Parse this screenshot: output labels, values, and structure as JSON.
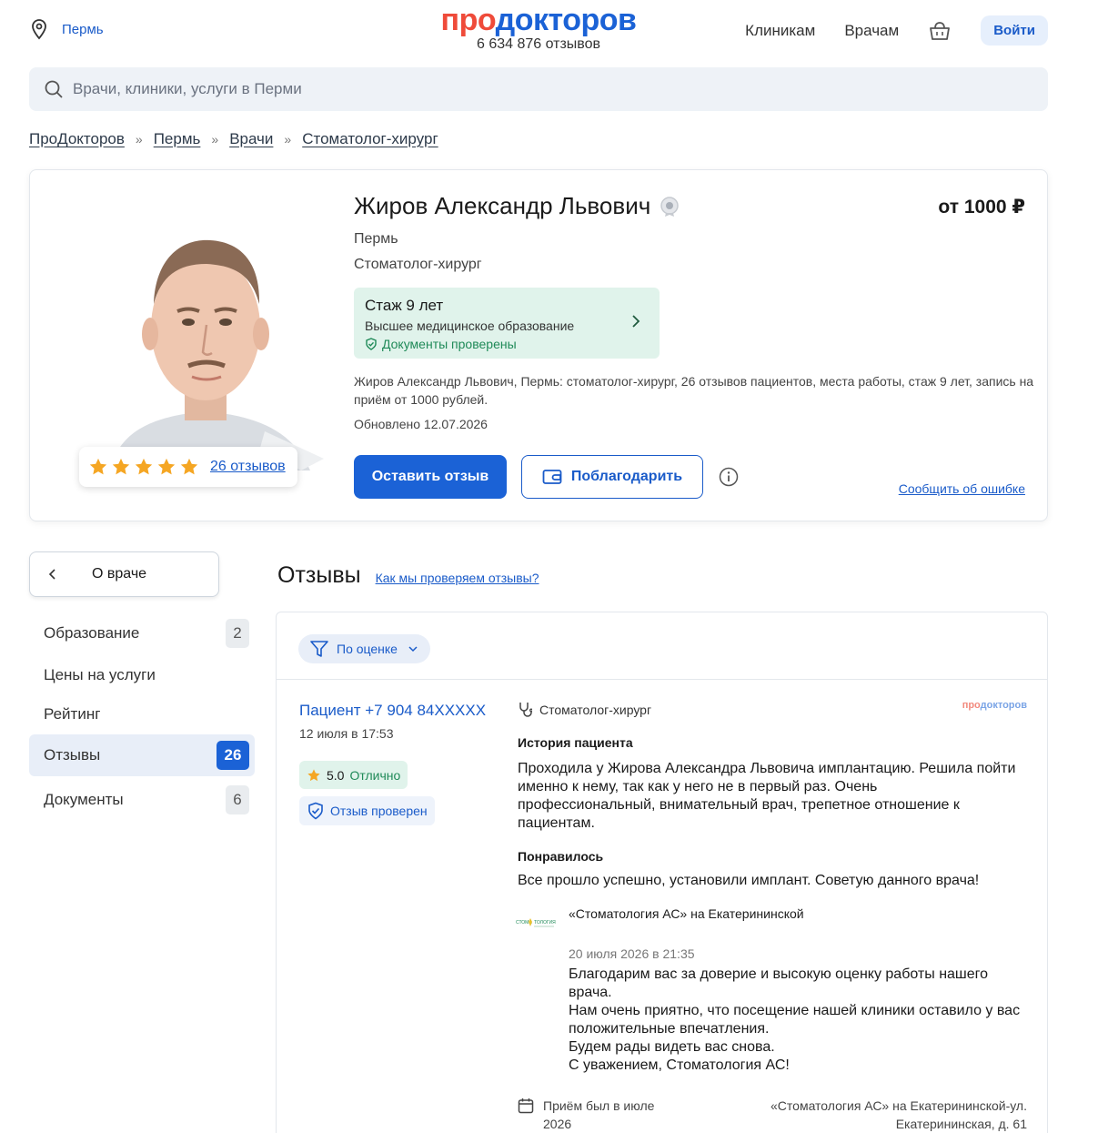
{
  "header": {
    "city": "Пермь",
    "logo_pro": "про",
    "logo_doc": "докторов",
    "reviews_count": "6 634 876 отзывов",
    "nav": [
      "Клиникам",
      "Врачам"
    ],
    "login": "Войти"
  },
  "search": {
    "placeholder": "Врачи, клиники, услуги в Перми"
  },
  "breadcrumb": [
    "ПроДокторов",
    "Пермь",
    "Врачи",
    "Стоматолог-хирург"
  ],
  "doctor": {
    "name": "Жиров Александр Львович",
    "price": "от 1000 ₽",
    "city": "Пермь",
    "specialty": "Стоматолог-хирург",
    "experience": "Стаж 9 лет",
    "education": "Высшее медицинское образование",
    "documents": "Документы проверены",
    "description": "Жиров Александр Львович, Пермь: стоматолог-хирург, 26 отзывов пациентов, места работы, стаж 9 лет, запись на приём от 1000 рублей.",
    "updated": "Обновлено 12.07.2026",
    "reviews_link": "26 отзывов",
    "rating_stars": 5,
    "btn_review": "Оставить отзыв",
    "btn_thank": "Поблагодарить",
    "report": "Сообщить об ошибке"
  },
  "sidebar": {
    "back": "О враче",
    "items": [
      {
        "label": "Образование",
        "badge": "2"
      },
      {
        "label": "Цены на услуги",
        "badge": ""
      },
      {
        "label": "Рейтинг",
        "badge": ""
      },
      {
        "label": "Отзывы",
        "badge": "26"
      },
      {
        "label": "Документы",
        "badge": "6"
      }
    ]
  },
  "reviews": {
    "title": "Отзывы",
    "how": "Как мы проверяем отзывы?",
    "filter": "По оценке",
    "item": {
      "author": "Пациент +7 904 84XXXXX",
      "date": "12 июля в 17:53",
      "score": "5.0",
      "score_label": "Отлично",
      "verified": "Отзыв проверен",
      "specialty": "Стоматолог-хирург",
      "source_pro": "про",
      "source_doc": "докторов",
      "story_h": "История пациента",
      "story": "Проходила у Жирова Александра Львовича имплантацию. Решила пойти именно к нему, так как у него не в первый раз. Очень профессиональный, внимательный врач, трепетное отношение к пациентам.",
      "liked_h": "Понравилось",
      "liked": "Все прошло успешно, установили имплант. Советую данного врача!",
      "clinic": "«Стоматология АС» на Екатерининской",
      "reply_date": "20 июля 2026 в 21:35",
      "reply": "Благодарим вас за доверие и высокую оценку работы нашего врача.\nНам очень приятно, что посещение нашей клиники оставило у вас положительные впечатления.\nБудем рады видеть вас снова.\nС уважением, Стоматология АС!",
      "visit": "Приём был в июле 2026",
      "address": "«Стоматология АС» на Екатерининской-ул. Екатерининская, д. 61"
    }
  },
  "colors": {
    "accent": "#1b62d6",
    "brand_red": "#ef4b3a",
    "green": "#1f8a58",
    "star": "#f5a623"
  }
}
